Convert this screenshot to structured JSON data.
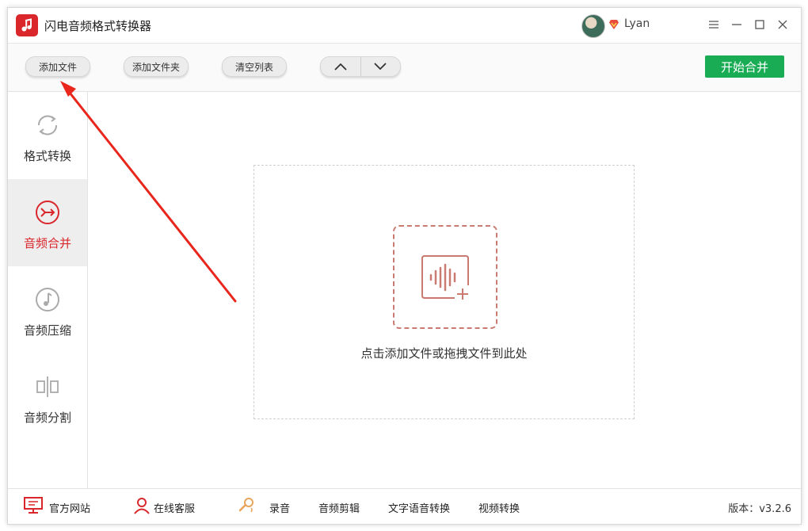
{
  "app": {
    "title": "闪电音频格式转换器"
  },
  "user": {
    "name": "Lyan"
  },
  "toolbar": {
    "add_file": "添加文件",
    "add_folder": "添加文件夹",
    "clear_list": "清空列表",
    "start_merge": "开始合并"
  },
  "sidebar": {
    "items": [
      {
        "label": "格式转换",
        "icon": "refresh-icon"
      },
      {
        "label": "音频合并",
        "icon": "merge-icon",
        "active": true
      },
      {
        "label": "音频压缩",
        "icon": "music-note-icon"
      },
      {
        "label": "音频分割",
        "icon": "split-icon"
      }
    ]
  },
  "main": {
    "drop_hint": "点击添加文件或拖拽文件到此处"
  },
  "bottom": {
    "website": "官方网站",
    "support": "在线客服",
    "record": "录音",
    "audio_edit": "音频剪辑",
    "tts": "文字语音转换",
    "video_convert": "视频转换",
    "version": "版本：v3.2.6"
  },
  "colors": {
    "accent": "#d9272c",
    "start_button": "#1aac55",
    "annotation_arrow": "#e8261c",
    "drop_icon": "#c97b72"
  }
}
